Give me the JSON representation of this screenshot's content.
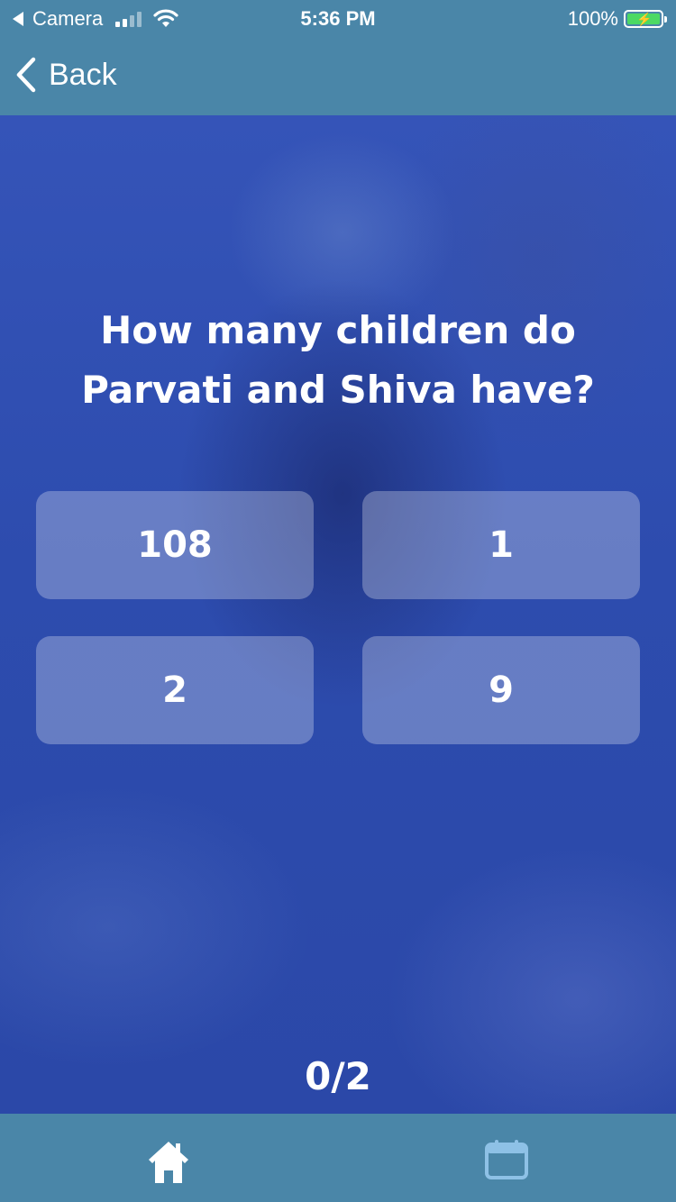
{
  "status_bar": {
    "carrier_back": "Camera",
    "time": "5:36 PM",
    "battery_percent": "100%",
    "signal_bars_filled": 2,
    "signal_bars_total": 4
  },
  "nav": {
    "back_label": "Back"
  },
  "quiz": {
    "question": "How many children do Parvati and Shiva have?",
    "answers": [
      "108",
      "1",
      "2",
      "9"
    ],
    "score": "0/2"
  },
  "tab_bar": {
    "icons": [
      "home-icon",
      "calendar-icon"
    ],
    "active_tab": "home"
  },
  "colors": {
    "header_bg": "#4a86a8",
    "content_bg": "#2f4fae",
    "battery_fill": "#4cd964",
    "inactive_tab": "#8ec1e6"
  }
}
